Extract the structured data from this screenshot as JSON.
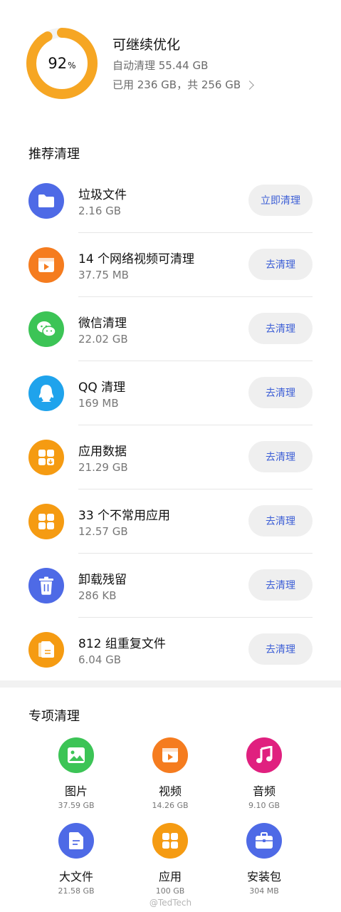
{
  "storage": {
    "percent": "92",
    "percent_sign": "%",
    "percent_value": 0.92,
    "title": "可继续优化",
    "auto_clean": "自动清理 55.44 GB",
    "used": "已用 236 GB，共 256 GB",
    "ring_color": "#f6a623",
    "ring_track": "#f2f2f2"
  },
  "recommended": {
    "title": "推荐清理",
    "items": [
      {
        "name": "垃圾文件",
        "size": "2.16 GB",
        "button": "立即清理",
        "icon": "folder-icon",
        "color": "#4e6ae6"
      },
      {
        "name": "14 个网络视频可清理",
        "size": "37.75 MB",
        "button": "去清理",
        "icon": "video-icon",
        "color": "#f57c1f"
      },
      {
        "name": "微信清理",
        "size": "22.02 GB",
        "button": "去清理",
        "icon": "wechat-icon",
        "color": "#3cc456"
      },
      {
        "name": "QQ 清理",
        "size": "169 MB",
        "button": "去清理",
        "icon": "qq-icon",
        "color": "#1fa3ec"
      },
      {
        "name": "应用数据",
        "size": "21.29 GB",
        "button": "去清理",
        "icon": "app-data-icon",
        "color": "#f59b12"
      },
      {
        "name": "33 个不常用应用",
        "size": "12.57 GB",
        "button": "去清理",
        "icon": "apps-icon",
        "color": "#f59b12"
      },
      {
        "name": "卸载残留",
        "size": "286 KB",
        "button": "去清理",
        "icon": "trash-icon",
        "color": "#4e6ae6"
      },
      {
        "name": "812 组重复文件",
        "size": "6.04 GB",
        "button": "去清理",
        "icon": "duplicate-files-icon",
        "color": "#f59b12"
      }
    ]
  },
  "special": {
    "title": "专项清理",
    "items": [
      {
        "label": "图片",
        "size": "37.59 GB",
        "icon": "image-icon",
        "color": "#3cc456"
      },
      {
        "label": "视频",
        "size": "14.26 GB",
        "icon": "video-icon",
        "color": "#f57c1f"
      },
      {
        "label": "音频",
        "size": "9.10 GB",
        "icon": "music-icon",
        "color": "#e0207f"
      },
      {
        "label": "大文件",
        "size": "21.58 GB",
        "icon": "document-icon",
        "color": "#4e6ae6"
      },
      {
        "label": "应用",
        "size": "100 GB",
        "icon": "apps-icon",
        "color": "#f59b12"
      },
      {
        "label": "安装包",
        "size": "304 MB",
        "icon": "package-icon",
        "color": "#4e6ae6"
      }
    ]
  },
  "watermark": "@TedTech"
}
